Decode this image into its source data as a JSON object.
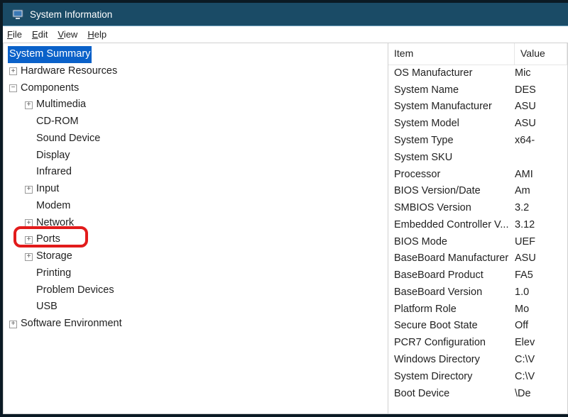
{
  "window": {
    "title": "System Information"
  },
  "menu": {
    "file": "File",
    "edit": "Edit",
    "view": "View",
    "help": "Help",
    "file_hotkey": "F",
    "edit_hotkey": "E",
    "view_hotkey": "V",
    "help_hotkey": "H"
  },
  "tree": {
    "root": "System Summary",
    "hardware_resources": "Hardware Resources",
    "components": "Components",
    "multimedia": "Multimedia",
    "cdrom": "CD-ROM",
    "sound_device": "Sound Device",
    "display": "Display",
    "infrared": "Infrared",
    "input": "Input",
    "modem": "Modem",
    "network": "Network",
    "ports": "Ports",
    "storage": "Storage",
    "printing": "Printing",
    "problem_devices": "Problem Devices",
    "usb": "USB",
    "software_environment": "Software Environment"
  },
  "list": {
    "col_item": "Item",
    "col_value": "Value",
    "rows": [
      {
        "item": "OS Manufacturer",
        "value": "Mic"
      },
      {
        "item": "System Name",
        "value": "DES"
      },
      {
        "item": "System Manufacturer",
        "value": "ASU"
      },
      {
        "item": "System Model",
        "value": "ASU"
      },
      {
        "item": "System Type",
        "value": "x64-"
      },
      {
        "item": "System SKU",
        "value": ""
      },
      {
        "item": "Processor",
        "value": "AMI"
      },
      {
        "item": "BIOS Version/Date",
        "value": "Am"
      },
      {
        "item": "SMBIOS Version",
        "value": "3.2"
      },
      {
        "item": "Embedded Controller V...",
        "value": "3.12"
      },
      {
        "item": "BIOS Mode",
        "value": "UEF"
      },
      {
        "item": "BaseBoard Manufacturer",
        "value": "ASU"
      },
      {
        "item": "BaseBoard Product",
        "value": "FA5"
      },
      {
        "item": "BaseBoard Version",
        "value": "1.0"
      },
      {
        "item": "Platform Role",
        "value": "Mo"
      },
      {
        "item": "Secure Boot State",
        "value": "Off"
      },
      {
        "item": "PCR7 Configuration",
        "value": "Elev"
      },
      {
        "item": "Windows Directory",
        "value": "C:\\V"
      },
      {
        "item": "System Directory",
        "value": "C:\\V"
      },
      {
        "item": "Boot Device",
        "value": "\\De"
      }
    ]
  },
  "annotation": {
    "highlight_target": "network"
  }
}
